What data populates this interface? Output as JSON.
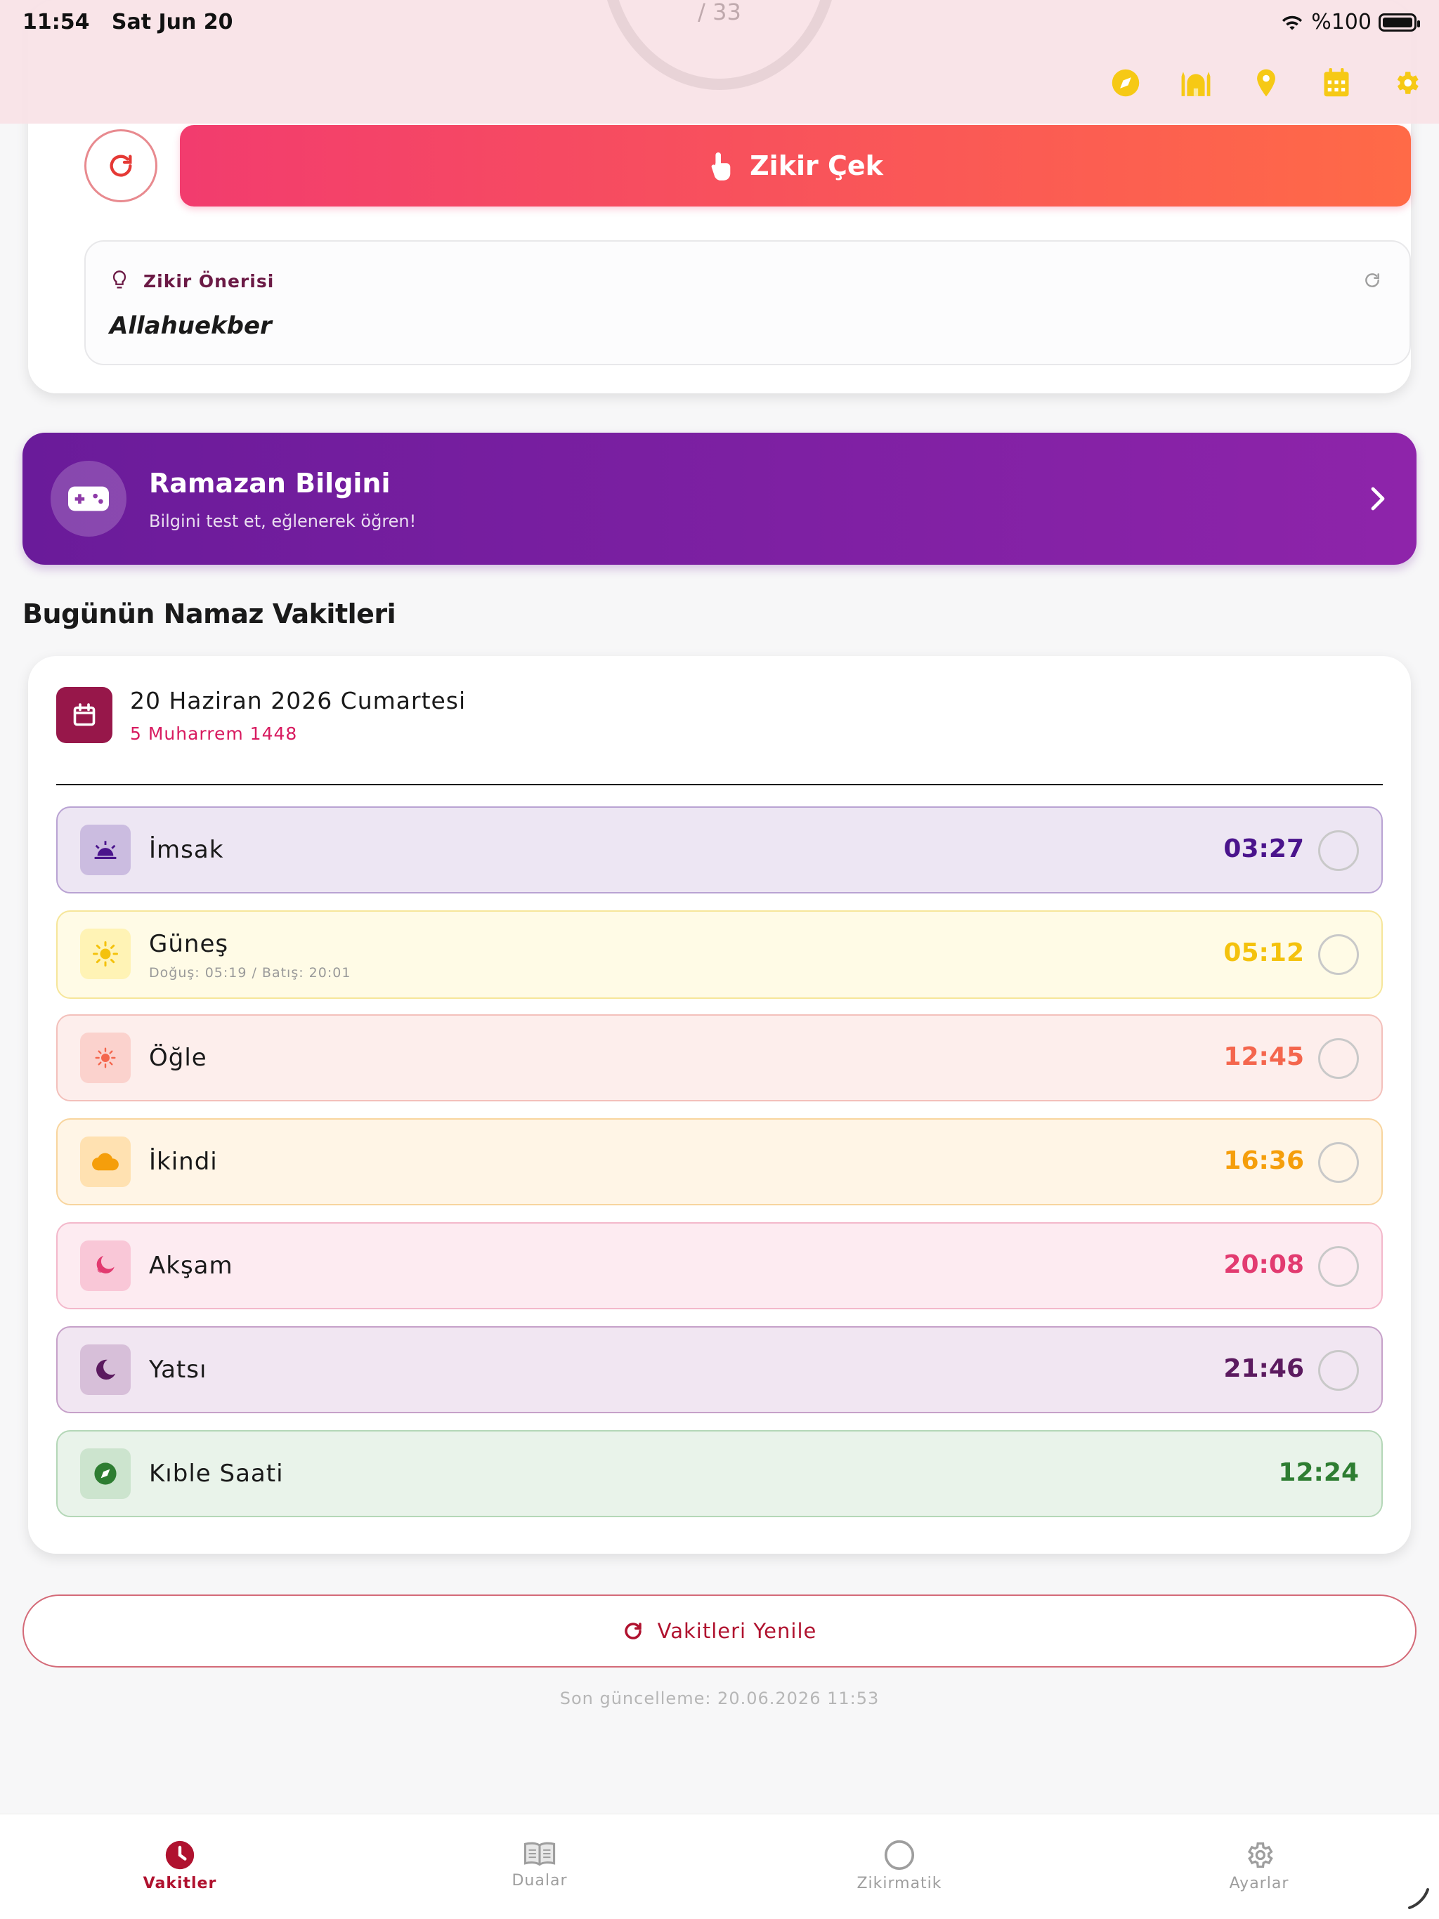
{
  "status_bar": {
    "time": "11:54",
    "date": "Sat Jun 20",
    "battery": "%100"
  },
  "counter": {
    "target": "/ 33"
  },
  "header_icons": [
    "compass-icon",
    "mosque-icon",
    "location-icon",
    "calendar-icon",
    "settings-icon"
  ],
  "zikir": {
    "button_label": "Zikir Çek",
    "suggestion_title": "Zikir Önerisi",
    "suggestion_text": "Allahuekber"
  },
  "ramazan": {
    "title": "Ramazan Bilgini",
    "subtitle": "Bilgini test et, eğlenerek öğren!"
  },
  "section_title": "Bugünün Namaz Vakitleri",
  "date": {
    "gregorian": "20 Haziran 2026 Cumartesi",
    "hijri": "5 Muharrem 1448"
  },
  "prayers": [
    {
      "name": "İmsak",
      "time": "03:27",
      "sub": "",
      "icon": "sunrise-icon",
      "bg": "#ede6f3",
      "border": "#b9a3d3",
      "icon_bg": "#cbbce0",
      "time_color": "#4a148c",
      "has_check": true
    },
    {
      "name": "Güneş",
      "time": "05:12",
      "sub": "Doğuş: 05:19 / Batış: 20:01",
      "icon": "sun-icon",
      "bg": "#fffbe6",
      "border": "#f6e69a",
      "icon_bg": "#fff3b5",
      "time_color": "#f4c20d",
      "has_check": true
    },
    {
      "name": "Öğle",
      "time": "12:45",
      "sub": "",
      "icon": "sun-bright-icon",
      "bg": "#fdeeec",
      "border": "#f3c0bb",
      "icon_bg": "#fbd2cd",
      "time_color": "#f4664d",
      "has_check": true
    },
    {
      "name": "İkindi",
      "time": "16:36",
      "sub": "",
      "icon": "cloud-icon",
      "bg": "#fff5e6",
      "border": "#f8d59e",
      "icon_bg": "#ffe1b1",
      "time_color": "#f59e0b",
      "has_check": true
    },
    {
      "name": "Akşam",
      "time": "20:08",
      "sub": "",
      "icon": "sunset-icon",
      "bg": "#fdebf1",
      "border": "#f3b8cb",
      "icon_bg": "#f9c7d7",
      "time_color": "#e23b70",
      "has_check": true
    },
    {
      "name": "Yatsı",
      "time": "21:46",
      "sub": "",
      "icon": "moon-icon",
      "bg": "#f1e6f2",
      "border": "#c6a1c9",
      "icon_bg": "#d7bfd9",
      "time_color": "#5b1a5f",
      "has_check": true
    },
    {
      "name": "Kıble Saati",
      "time": "12:24",
      "sub": "",
      "icon": "compass-icon",
      "bg": "#e9f3ea",
      "border": "#b4d7b7",
      "icon_bg": "#cce4ce",
      "time_color": "#2e7d32",
      "has_check": false
    }
  ],
  "refresh": {
    "label": "Vakitleri Yenile",
    "last_update": "Son güncelleme: 20.06.2026 11:53"
  },
  "nav": [
    {
      "label": "Vakitler",
      "icon": "clock-icon",
      "active": true
    },
    {
      "label": "Dualar",
      "icon": "book-icon",
      "active": false
    },
    {
      "label": "Zikirmatik",
      "icon": "circle-icon",
      "active": false
    },
    {
      "label": "Ayarlar",
      "icon": "gear-icon",
      "active": false
    }
  ],
  "colors": {
    "accent": "#b0122f",
    "icon_yellow": "#f6c915",
    "zikir_gradient_start": "#f23c6e",
    "zikir_gradient_end": "#ff6a47",
    "ramazan_start": "#6a1b9a",
    "ramazan_end": "#8e24aa"
  }
}
